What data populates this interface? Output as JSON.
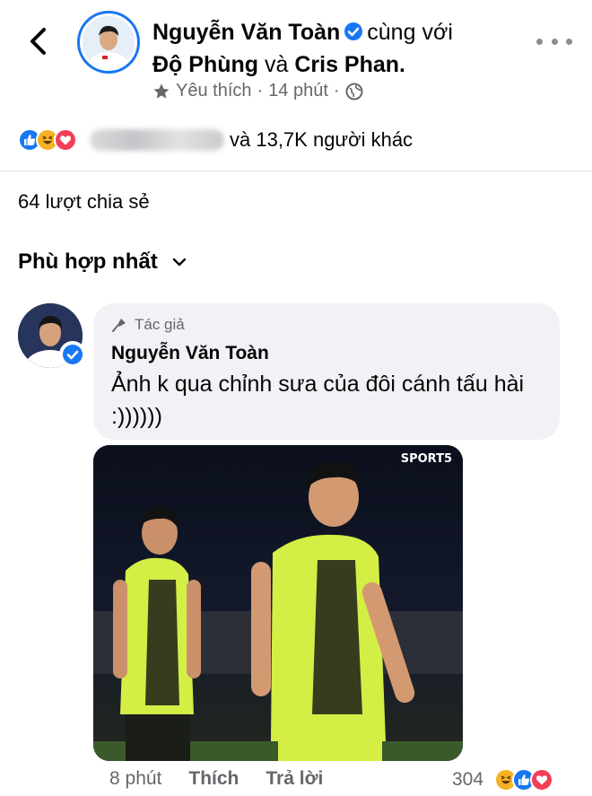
{
  "post": {
    "author": "Nguyễn Văn Toàn",
    "with_label": "cùng với",
    "tagged_1": "Độ Phùng",
    "and_label": "và",
    "tagged_2": "Cris Phan.",
    "favorite_label": "Yêu thích",
    "separator": "·",
    "time": "14 phút",
    "privacy_icon": "globe-icon"
  },
  "reactions": {
    "icons": [
      "like",
      "haha",
      "love"
    ],
    "others": "và 13,7K người khác"
  },
  "shares": "64 lượt chia sẻ",
  "sort_label": "Phù hợp nhất",
  "comment": {
    "author_tag": "Tác giả",
    "author": "Nguyễn Văn Toàn",
    "text": "Ảnh k qua chỉnh sưa của đôi cánh tấu hài :))))))",
    "photo_logo": "SPORT5",
    "time": "8 phút",
    "like_label": "Thích",
    "reply_label": "Trả lời",
    "reaction_count": "304"
  },
  "colors": {
    "facebook_blue": "#1877f2",
    "love_red": "#f33e58",
    "haha_yellow": "#f7b125",
    "secondary_text": "#65676b",
    "bubble": "#f0f2f5",
    "jersey": "#d7f04a"
  }
}
